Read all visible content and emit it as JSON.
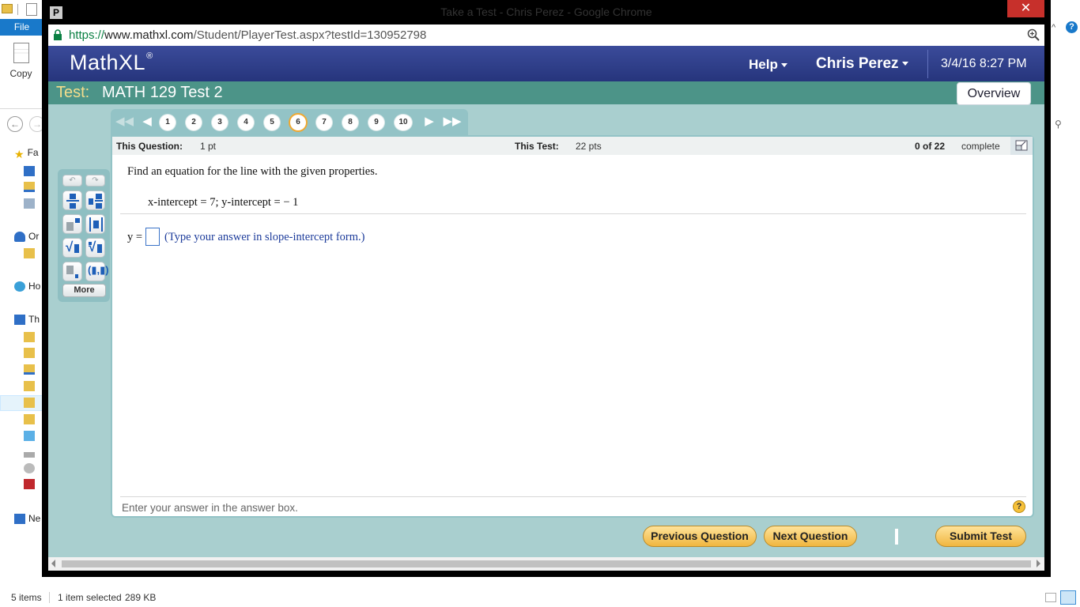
{
  "explorer": {
    "file_tab": "File",
    "copy_label": "Copy",
    "nav_items": [
      {
        "label": "Fa",
        "icon": "star-icon"
      },
      {
        "label": "",
        "icon": "desktop-icon"
      },
      {
        "label": "",
        "icon": "downloads-folder-icon"
      },
      {
        "label": "",
        "icon": "recent-places-icon"
      },
      {
        "label": "Or",
        "icon": "onedrive-icon"
      },
      {
        "label": "",
        "icon": "folder-icon"
      },
      {
        "label": "Ho",
        "icon": "homegroup-icon"
      },
      {
        "label": "Th",
        "icon": "this-pc-icon"
      },
      {
        "label": "",
        "icon": "folder-icon"
      },
      {
        "label": "",
        "icon": "documents-folder-icon"
      },
      {
        "label": "",
        "icon": "downloads-folder-icon"
      },
      {
        "label": "",
        "icon": "music-folder-icon"
      },
      {
        "label": "",
        "icon": "pictures-folder-icon"
      },
      {
        "label": "",
        "icon": "videos-folder-icon"
      },
      {
        "label": "",
        "icon": "windows-drive-icon"
      },
      {
        "label": "",
        "icon": "drive-icon"
      },
      {
        "label": "",
        "icon": "dvd-drive-icon"
      },
      {
        "label": "",
        "icon": "sd-card-icon"
      },
      {
        "label": "Ne",
        "icon": "network-icon"
      }
    ],
    "status_items": "5 items",
    "status_selected": "1 item selected",
    "status_size": "289 KB"
  },
  "browser": {
    "window_title": "Take a Test - Chris Perez - Google Chrome",
    "url_protocol": "https://",
    "url_domain": "www.mathxl.com",
    "url_path": "/Student/PlayerTest.aspx?testId=130952798"
  },
  "mathxl": {
    "logo": "MathXL",
    "logo_mark": "®",
    "help_menu": "Help",
    "user_menu": "Chris Perez",
    "datetime": "3/4/16 8:27 PM",
    "test_label": "Test:",
    "test_name": "MATH 129 Test 2",
    "overview_button": "Overview",
    "question_numbers": [
      "1",
      "2",
      "3",
      "4",
      "5",
      "6",
      "7",
      "8",
      "9",
      "10"
    ],
    "current_question": "6",
    "this_question_label": "This Question:",
    "this_question_pts": "1 pt",
    "this_test_label": "This Test:",
    "this_test_pts": "22 pts",
    "progress_count": "0 of 22",
    "progress_label": "complete",
    "problem_text": "Find an equation for the line with the given properties.",
    "given_text": "x-intercept = 7; y-intercept = − 1",
    "answer_prefix": "y =",
    "answer_value": "",
    "answer_hint": "(Type your answer in slope-intercept form.)",
    "footer_instruction": "Enter your answer in the answer box.",
    "palette_more": "More",
    "previous_button": "Previous Question",
    "next_button": "Next Question",
    "submit_button": "Submit Test"
  },
  "colors": {
    "mathxl_header": "#2d3c86",
    "test_bar": "#4c9488",
    "page_bg": "#a9cfcf",
    "button_gold": "#f5c860",
    "test_label": "#f4dd8c",
    "current_question_ring": "#f0a830"
  }
}
